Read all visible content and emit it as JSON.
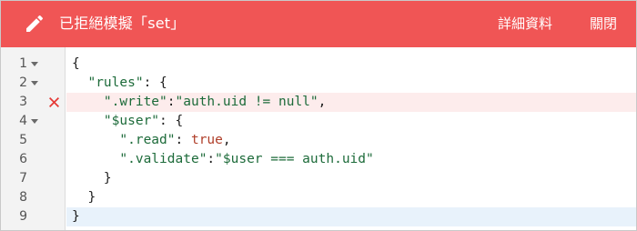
{
  "header": {
    "title": "已拒絕模擬「set」",
    "details_label": "詳細資料",
    "close_label": "關閉",
    "background_color": "#f05555",
    "icon": "pencil-icon"
  },
  "editor": {
    "error_line": 3,
    "active_line": 9,
    "lines": [
      {
        "num": "1",
        "fold": true,
        "tokens": [
          {
            "t": "{",
            "c": "p"
          }
        ]
      },
      {
        "num": "2",
        "fold": true,
        "tokens": [
          {
            "t": "  ",
            "c": "p"
          },
          {
            "t": "\"rules\"",
            "c": "s"
          },
          {
            "t": ": {",
            "c": "p"
          }
        ]
      },
      {
        "num": "3",
        "fold": false,
        "tokens": [
          {
            "t": "    ",
            "c": "p"
          },
          {
            "t": "\".write\"",
            "c": "s"
          },
          {
            "t": ":",
            "c": "p"
          },
          {
            "t": "\"auth.uid != null\"",
            "c": "s"
          },
          {
            "t": ",",
            "c": "p"
          }
        ]
      },
      {
        "num": "4",
        "fold": true,
        "tokens": [
          {
            "t": "    ",
            "c": "p"
          },
          {
            "t": "\"$user\"",
            "c": "s"
          },
          {
            "t": ": {",
            "c": "p"
          }
        ]
      },
      {
        "num": "5",
        "fold": false,
        "tokens": [
          {
            "t": "      ",
            "c": "p"
          },
          {
            "t": "\".read\"",
            "c": "s"
          },
          {
            "t": ": ",
            "c": "p"
          },
          {
            "t": "true",
            "c": "k"
          },
          {
            "t": ",",
            "c": "p"
          }
        ]
      },
      {
        "num": "6",
        "fold": false,
        "tokens": [
          {
            "t": "      ",
            "c": "p"
          },
          {
            "t": "\".validate\"",
            "c": "s"
          },
          {
            "t": ":",
            "c": "p"
          },
          {
            "t": "\"$user === auth.uid\"",
            "c": "s"
          }
        ]
      },
      {
        "num": "7",
        "fold": false,
        "tokens": [
          {
            "t": "    }",
            "c": "p"
          }
        ]
      },
      {
        "num": "8",
        "fold": false,
        "tokens": [
          {
            "t": "  }",
            "c": "p"
          }
        ]
      },
      {
        "num": "9",
        "fold": false,
        "tokens": [
          {
            "t": "}",
            "c": "p"
          }
        ]
      }
    ]
  }
}
